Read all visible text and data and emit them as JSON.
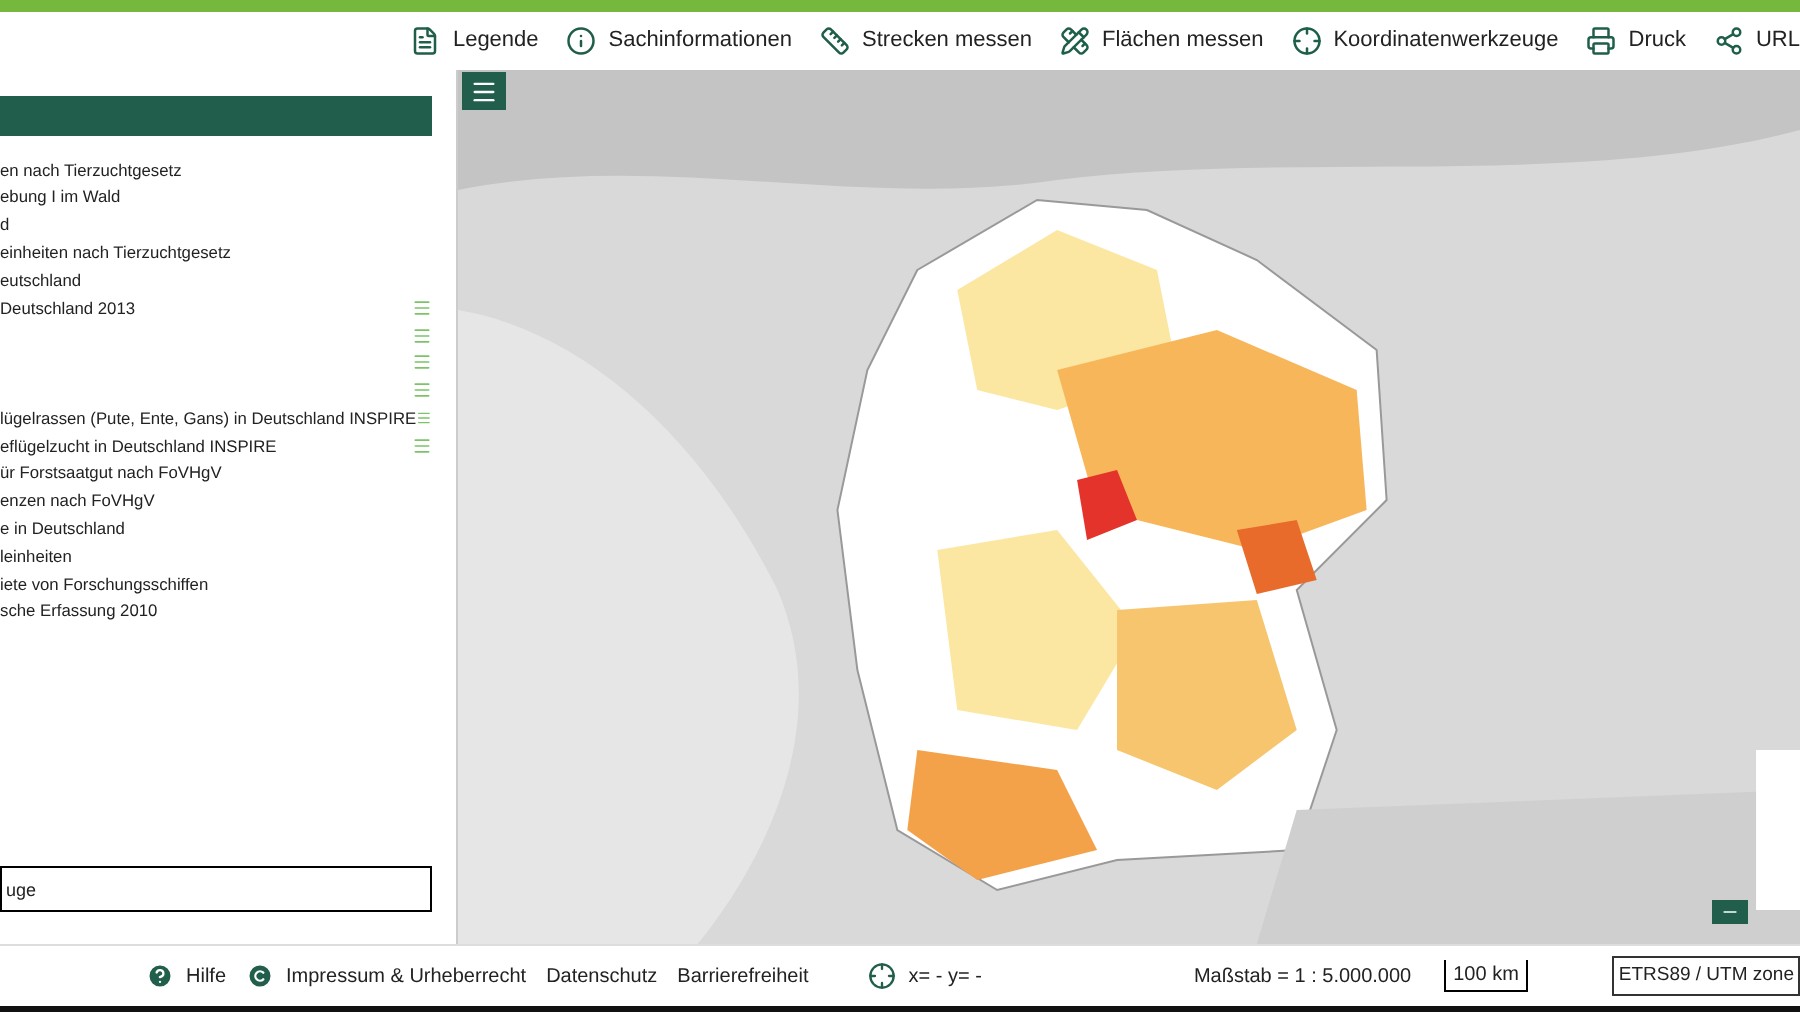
{
  "toolbar": [
    {
      "kind": "legend",
      "label": "Legende"
    },
    {
      "kind": "info",
      "label": "Sachinformationen"
    },
    {
      "kind": "distance",
      "label": "Strecken messen"
    },
    {
      "kind": "area",
      "label": "Flächen messen"
    },
    {
      "kind": "coords",
      "label": "Koordinatenwerkzeuge"
    },
    {
      "kind": "print",
      "label": "Druck"
    },
    {
      "kind": "share",
      "label": "URL"
    }
  ],
  "layers": [
    {
      "label": "en nach Tierzuchtgesetz",
      "menu": false
    },
    {
      "label": "ebung I im Wald",
      "menu": false
    },
    {
      "label": "d",
      "menu": false
    },
    {
      "label": "einheiten nach Tierzuchtgesetz",
      "menu": false
    },
    {
      "label": "eutschland",
      "menu": false
    },
    {
      "label": " Deutschland 2013",
      "menu": true
    },
    {
      "menu": true
    },
    {
      "menu": true
    },
    {
      "menu": true
    },
    {
      "label": "lügelrassen (Pute, Ente, Gans) in Deutschland INSPIRE",
      "menu": true
    },
    {
      "label": "eflügelzucht in Deutschland INSPIRE",
      "menu": true
    },
    {
      "label": "ür Forstsaatgut nach FoVHgV",
      "menu": false
    },
    {
      "label": "enzen nach FoVHgV",
      "menu": false
    },
    {
      "label": "e in Deutschland",
      "menu": false
    },
    {
      "label": "leinheiten",
      "menu": false
    },
    {
      "label": "iete von Forschungsschiffen",
      "menu": false
    },
    {
      "label": "sche Erfassung 2010",
      "menu": false
    }
  ],
  "search": {
    "value": "uge"
  },
  "footer": {
    "links": [
      {
        "kind": "help",
        "label": "Hilfe"
      },
      {
        "kind": "copyright",
        "label": "Impressum & Urheberrecht"
      },
      {
        "kind": "plain",
        "label": "Datenschutz"
      },
      {
        "kind": "plain",
        "label": "Barrierefreiheit"
      }
    ],
    "coordinates": "x= - y= -",
    "scale": "Maßstab = 1 : 5.000.000",
    "scale_bar": "100 km",
    "crs": "ETRS89 / UTM zone"
  }
}
